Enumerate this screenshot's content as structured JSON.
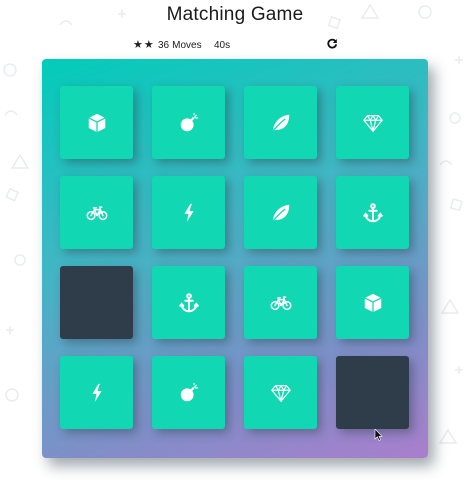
{
  "title": "Matching Game",
  "score_panel": {
    "stars": [
      {
        "icon": "star-icon",
        "glyph": "★"
      },
      {
        "icon": "star-icon",
        "glyph": "★"
      }
    ],
    "moves_count": "36",
    "moves_label": "Moves",
    "timer_value": "40",
    "timer_unit": "s",
    "restart_icon": "restart-icon"
  },
  "colors": {
    "card_open": "#12d7b3",
    "card_closed": "#2e3d49",
    "deck_gradient_start": "#02ccba",
    "deck_gradient_end": "#aa7ecd"
  },
  "deck": {
    "rows": 4,
    "cols": 4,
    "cards": [
      {
        "state": "open",
        "icon": "cube-icon"
      },
      {
        "state": "open",
        "icon": "bomb-icon"
      },
      {
        "state": "open",
        "icon": "leaf-icon"
      },
      {
        "state": "open",
        "icon": "diamond-icon"
      },
      {
        "state": "open",
        "icon": "bicycle-icon"
      },
      {
        "state": "open",
        "icon": "bolt-icon"
      },
      {
        "state": "open",
        "icon": "leaf-icon"
      },
      {
        "state": "open",
        "icon": "anchor-icon"
      },
      {
        "state": "closed",
        "icon": ""
      },
      {
        "state": "open",
        "icon": "anchor-icon"
      },
      {
        "state": "open",
        "icon": "bicycle-icon"
      },
      {
        "state": "open",
        "icon": "cube-icon"
      },
      {
        "state": "open",
        "icon": "bolt-icon"
      },
      {
        "state": "open",
        "icon": "bomb-icon"
      },
      {
        "state": "open",
        "icon": "diamond-icon"
      },
      {
        "state": "closed",
        "icon": ""
      }
    ]
  }
}
